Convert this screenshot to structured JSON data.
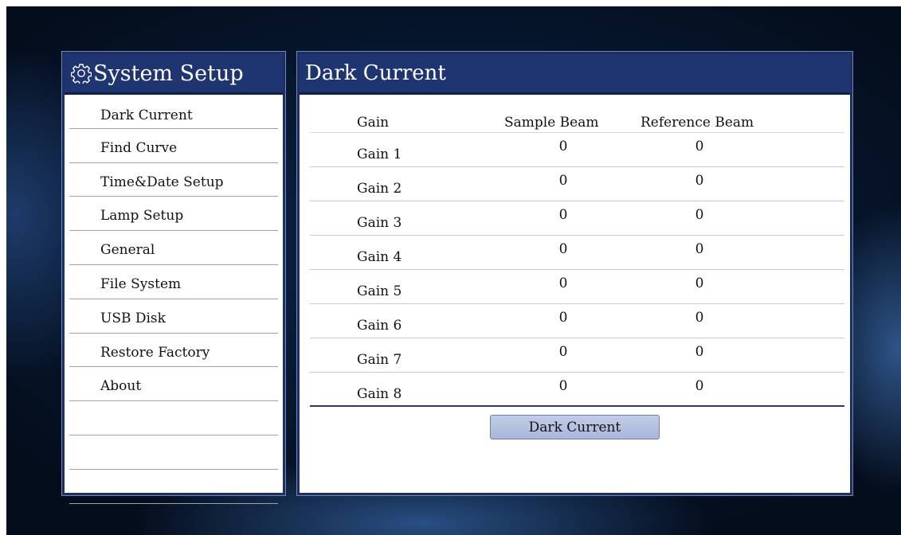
{
  "sidebar": {
    "title": "System Setup",
    "items": [
      {
        "label": "Dark Current"
      },
      {
        "label": "Find Curve"
      },
      {
        "label": "Time&Date Setup"
      },
      {
        "label": "Lamp Setup"
      },
      {
        "label": "General"
      },
      {
        "label": "File System"
      },
      {
        "label": "USB Disk"
      },
      {
        "label": "Restore Factory"
      },
      {
        "label": "About"
      },
      {
        "label": ""
      },
      {
        "label": ""
      },
      {
        "label": ""
      }
    ]
  },
  "main": {
    "title": "Dark Current",
    "table": {
      "headers": [
        "Gain",
        "Sample Beam",
        "Reference Beam"
      ],
      "rows": [
        [
          "Gain 1",
          "0",
          "0"
        ],
        [
          "Gain 2",
          "0",
          "0"
        ],
        [
          "Gain 3",
          "0",
          "0"
        ],
        [
          "Gain 4",
          "0",
          "0"
        ],
        [
          "Gain 5",
          "0",
          "0"
        ],
        [
          "Gain 6",
          "0",
          "0"
        ],
        [
          "Gain 7",
          "0",
          "0"
        ],
        [
          "Gain 8",
          "0",
          "0"
        ]
      ]
    },
    "button_label": "Dark Current"
  },
  "icons": {
    "settings": "gear-icon"
  },
  "colors": {
    "header_bg": "#1e3571",
    "button_bg": "#b4c0e1"
  }
}
